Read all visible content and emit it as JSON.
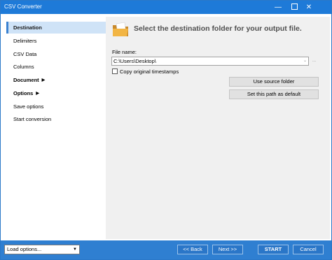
{
  "window": {
    "title": "CSV Converter",
    "minimize_glyph": "—",
    "close_glyph": "✕"
  },
  "sidebar": {
    "items": [
      {
        "label": "Destination",
        "active": true
      },
      {
        "label": "Delimiters"
      },
      {
        "label": "CSV Data"
      },
      {
        "label": "Columns"
      },
      {
        "label": "Document",
        "submenu": true
      },
      {
        "label": "Options",
        "submenu": true
      },
      {
        "label": "Save options"
      },
      {
        "label": "Start conversion"
      }
    ],
    "submenu_glyph": "▶"
  },
  "content": {
    "heading": "Select the destination folder for your output file.",
    "file_name_label": "File name:",
    "file_name_value": "C:\\Users\\Desktop\\",
    "checkbox_label": "Copy original timestamps",
    "checkbox_checked": false,
    "use_source_button": "Use source folder",
    "set_default_button": "Set this path as default",
    "dropdown_glyph": "⌄",
    "browse_glyph": "..."
  },
  "footer": {
    "load_options": "Load options...",
    "back": "<< Back",
    "next": "Next >>",
    "start": "START",
    "cancel": "Cancel",
    "select_glyph": "▼"
  },
  "colors": {
    "titlebar": "#1e7ad8",
    "footer": "#2f7fd1",
    "active_nav": "#cfe3f7",
    "content_bg": "#f0f0f0"
  }
}
